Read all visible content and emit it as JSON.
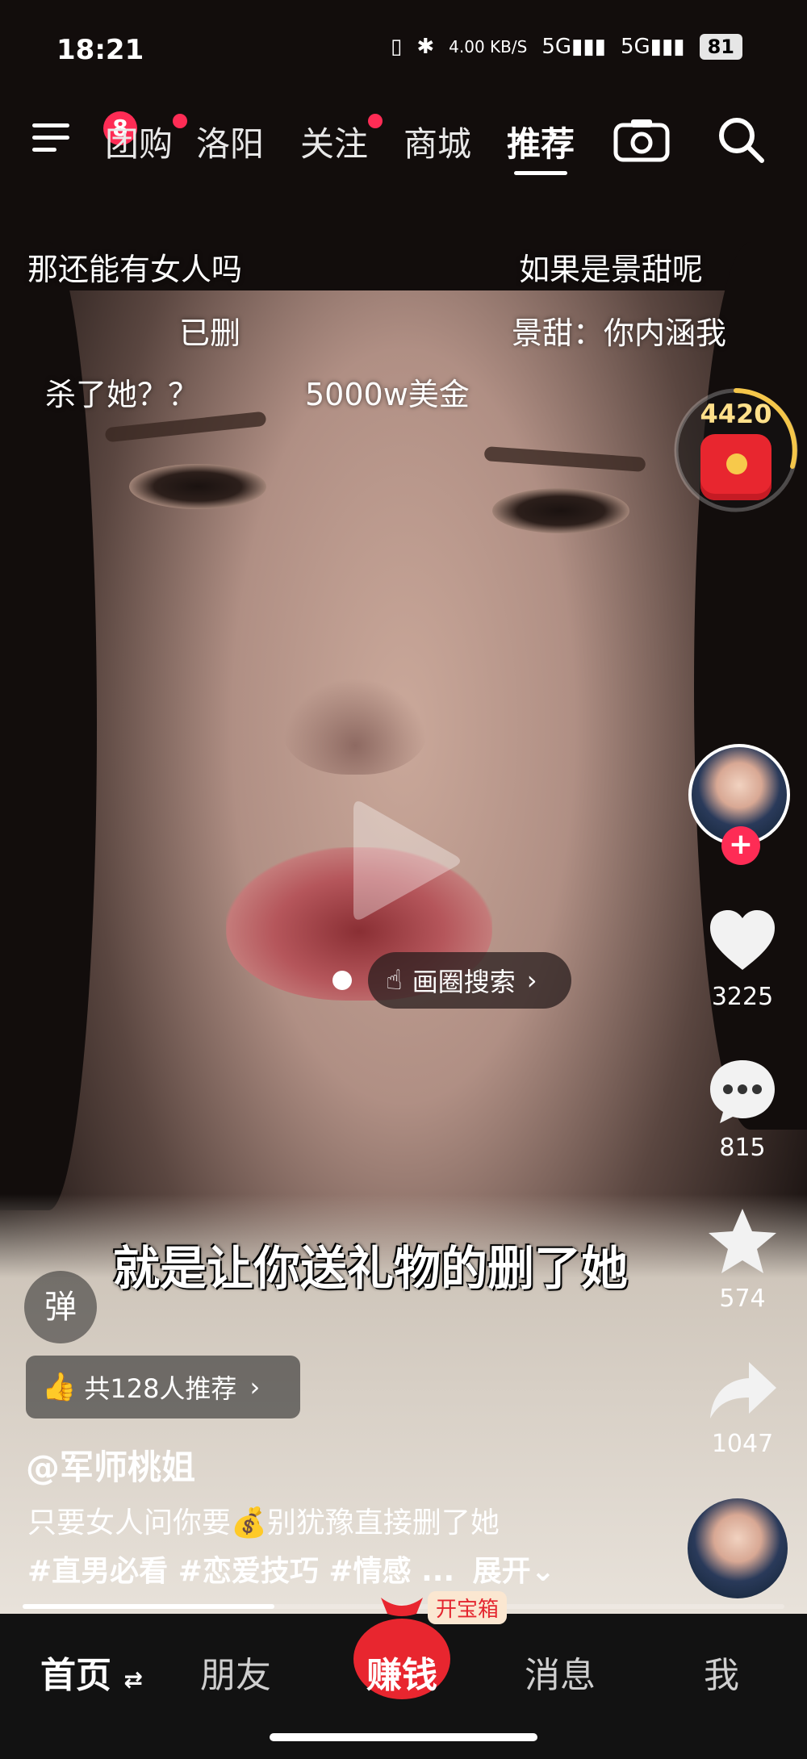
{
  "status_bar": {
    "time": "18:21",
    "network_speed": "4.00 KB/S",
    "signal_1": "5G",
    "signal_2": "5G",
    "battery": "81"
  },
  "top_nav": {
    "menu_badge": "8",
    "tabs": [
      {
        "label": "团购",
        "has_dot": true
      },
      {
        "label": "洛阳",
        "has_dot": false
      },
      {
        "label": "关注",
        "has_dot": true
      },
      {
        "label": "商城",
        "has_dot": false
      },
      {
        "label": "推荐",
        "active": true
      }
    ],
    "camera_icon": "camera-icon",
    "search_icon": "search-icon"
  },
  "danmaku": [
    "那还能有女人吗",
    "如果是景甜呢",
    "已删",
    "景甜：你内涵我",
    "杀了她？？",
    "5000w美金"
  ],
  "red_packet": {
    "count": "4420"
  },
  "circle_search": {
    "label": "画圈搜索"
  },
  "caption": "就是让你送礼物的删了她",
  "actions": {
    "likes": "3225",
    "comments": "815",
    "favorites": "574",
    "shares": "1047"
  },
  "danmu_toggle": "弹",
  "recommend": {
    "label": "共128人推荐"
  },
  "video_info": {
    "author": "@军师桃姐",
    "desc_part1": "只要女人问你要",
    "desc_emoji": "💰",
    "desc_part2": "别犹豫直接删了她",
    "tags": "#直男必看 #恋爱技巧 #情感 ...",
    "expand": "展开"
  },
  "progress": 0.33,
  "bottom_nav": {
    "home": "首页",
    "friends": "朋友",
    "earn": "赚钱",
    "earn_badge": "开宝箱",
    "messages": "消息",
    "me": "我"
  },
  "colors": {
    "accent": "#fe2c55",
    "red_packet": "#e8262f"
  }
}
